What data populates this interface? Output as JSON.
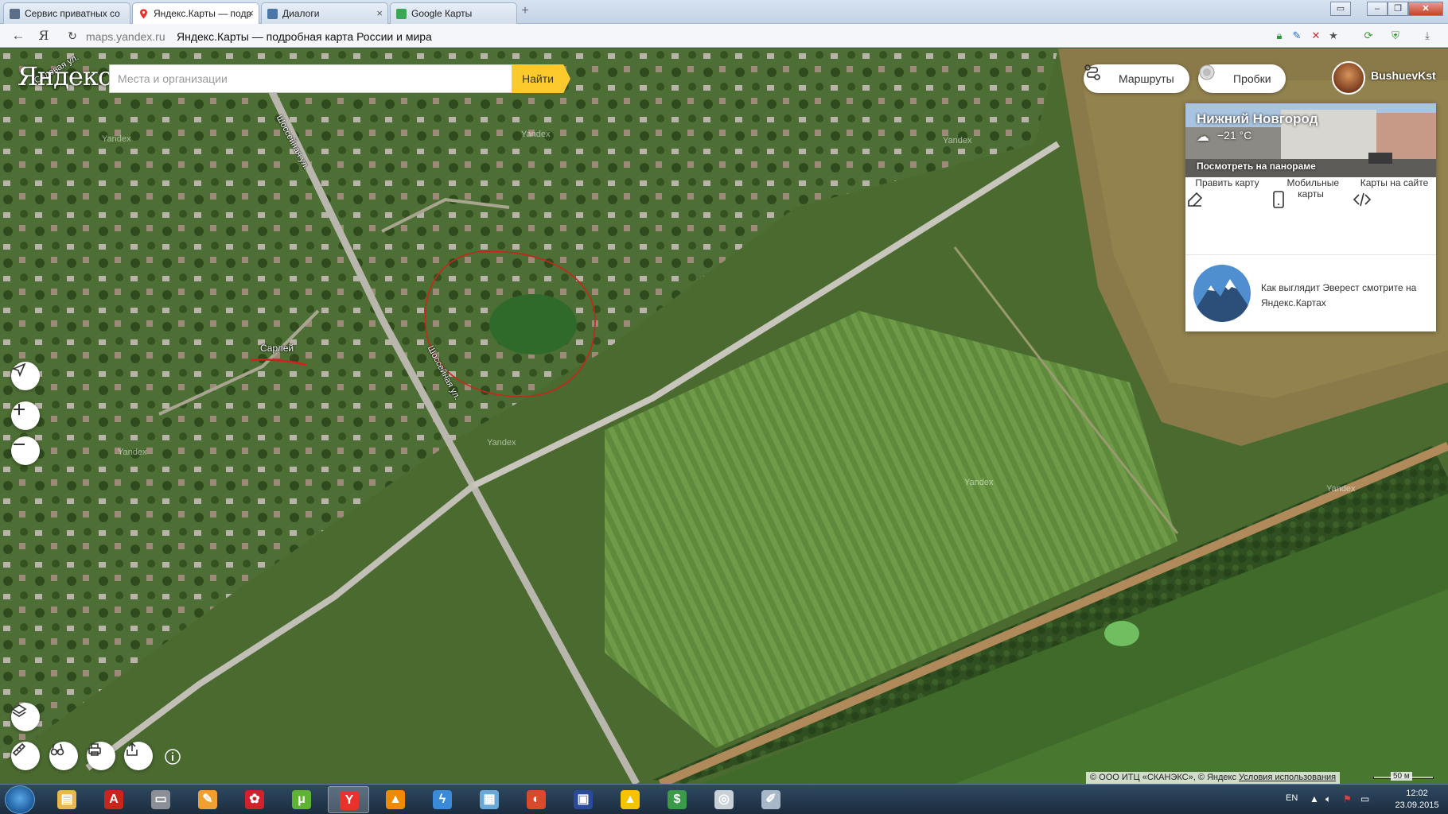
{
  "browser": {
    "tabs": [
      {
        "label": "Сервис приватных со",
        "favicon_color": "#5b6f8a"
      },
      {
        "label": "Яндекс.Карты — подр",
        "favicon_color": "#e8322b"
      },
      {
        "label": "Диалоги",
        "favicon_color": "#4a76a8"
      },
      {
        "label": "Google Карты",
        "favicon_color": "#3aa757"
      }
    ],
    "new_tab": "+",
    "url_domain": "maps.yandex.ru",
    "url_title": "Яндекс.Карты — подробная карта России и мира",
    "yandex_button": "Я"
  },
  "map": {
    "logo": "Яндекс",
    "search": {
      "placeholder": "Места и организации",
      "value": "",
      "button": "Найти"
    },
    "routes_button": "Маршруты",
    "traffic_button": "Пробки",
    "user_name": "BushuevKst",
    "place_label": "Сарлей",
    "street_labels": [
      "Шоссейная ул.",
      "Шоссейная ул.",
      "Садовая ул."
    ],
    "watermarks": [
      "Yandex",
      "Yandex",
      "Yandex",
      "Yandex",
      "Yandex",
      "Yandex",
      "Yandex"
    ],
    "side_panel": {
      "city": "Нижний Новгород",
      "weather": "−21 °C",
      "panorama_link": "Посмотреть на панораме",
      "actions": [
        {
          "label": "Править карту",
          "icon": "edit-icon"
        },
        {
          "label": "Мобильные карты",
          "icon": "mobile-icon"
        },
        {
          "label": "Карты на сайте",
          "icon": "code-icon"
        }
      ],
      "promo": "Как выглядит Эверест смотрите на Яндекс.Картах"
    },
    "copyright": "© ООО ИТЦ «СКАНЭКС», © Яндекс",
    "terms_link": "Условия использования",
    "scale": "50 м"
  },
  "taskbar": {
    "apps": [
      {
        "name": "explorer",
        "color": "#e8b84a",
        "glyph": "▤"
      },
      {
        "name": "acrobat",
        "color": "#c8261c",
        "glyph": "A"
      },
      {
        "name": "scanner",
        "color": "#8a8f98",
        "glyph": "▭"
      },
      {
        "name": "paint",
        "color": "#f0a030",
        "glyph": "✎"
      },
      {
        "name": "huawei",
        "color": "#d3212b",
        "glyph": "✿"
      },
      {
        "name": "utorrent",
        "color": "#5fb331",
        "glyph": "μ"
      },
      {
        "name": "yandex-browser",
        "color": "#e8322b",
        "glyph": "Y"
      },
      {
        "name": "vlc",
        "color": "#f08a00",
        "glyph": "▲"
      },
      {
        "name": "flash",
        "color": "#3a8ad8",
        "glyph": "ϟ"
      },
      {
        "name": "calculator",
        "color": "#6aa8d8",
        "glyph": "▦"
      },
      {
        "name": "media",
        "color": "#d84a2a",
        "glyph": "◐"
      },
      {
        "name": "floppy",
        "color": "#2a4a9a",
        "glyph": "▣"
      },
      {
        "name": "aimp",
        "color": "#f5c400",
        "glyph": "▲"
      },
      {
        "name": "money",
        "color": "#3a9a4a",
        "glyph": "$"
      },
      {
        "name": "disc",
        "color": "#c8d0d8",
        "glyph": "◎"
      },
      {
        "name": "paint-brush",
        "color": "#a8b8c8",
        "glyph": "✐"
      }
    ],
    "language": "EN",
    "time": "12:02",
    "date": "23.09.2015"
  }
}
